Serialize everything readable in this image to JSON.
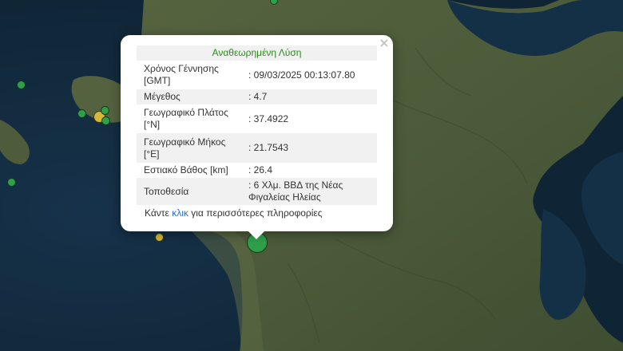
{
  "colors": {
    "sea": "#122a3c",
    "land": "#4b5a39",
    "marker_green": "#2fa04a",
    "marker_yellow": "#d6b83a",
    "popup_title": "#2d8a1e",
    "link": "#2a6fb8"
  },
  "markers": [
    {
      "name": "earthquake-marker-selected",
      "color": "green",
      "size": "large"
    },
    {
      "name": "earthquake-marker",
      "color": "green",
      "size": "small"
    },
    {
      "name": "earthquake-marker",
      "color": "green",
      "size": "small"
    },
    {
      "name": "earthquake-marker",
      "color": "yellow",
      "size": "small"
    },
    {
      "name": "earthquake-marker",
      "color": "green",
      "size": "small"
    },
    {
      "name": "earthquake-marker",
      "color": "green",
      "size": "small"
    },
    {
      "name": "earthquake-marker",
      "color": "green",
      "size": "small"
    },
    {
      "name": "earthquake-marker",
      "color": "yellow",
      "size": "small"
    },
    {
      "name": "earthquake-marker",
      "color": "green",
      "size": "small"
    }
  ],
  "popup": {
    "close_icon": "×",
    "title": "Αναθεωρημένη Λύση",
    "rows": [
      {
        "label": "Χρόνος Γέννησης [GMT]",
        "value": ": 09/03/2025 00:13:07.80"
      },
      {
        "label": "Μέγεθος",
        "value": ": 4.7"
      },
      {
        "label": "Γεωγραφικό Πλάτος [°N]",
        "value": ": 37.4922"
      },
      {
        "label": "Γεωγραφικό Μήκος [°E]",
        "value": ": 21.7543"
      },
      {
        "label": "Εστιακό Βάθος [km]",
        "value": ": 26.4"
      },
      {
        "label": "Τοποθεσία",
        "value": ": 6 Χλμ. ΒΒΔ της Νέας Φιγαλείας Ηλείας"
      }
    ],
    "more_prefix": "Κάντε",
    "more_link": "κλικ",
    "more_suffix": "για περισσότερες πληροφορίες"
  }
}
